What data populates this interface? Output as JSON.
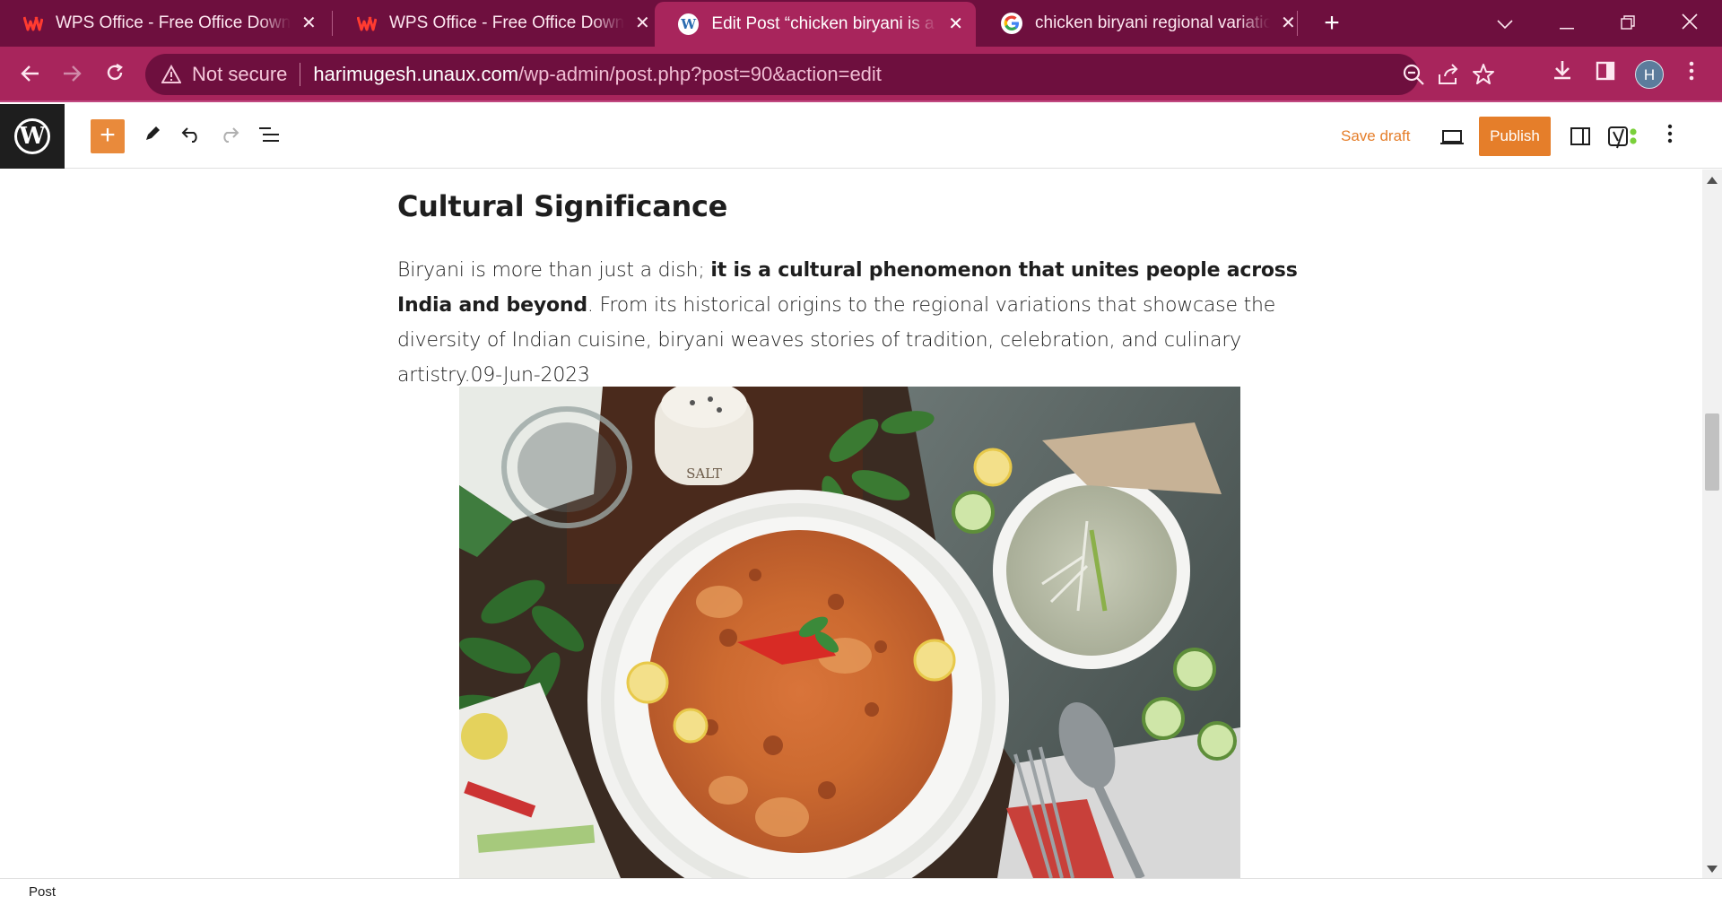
{
  "browser": {
    "tabs": [
      {
        "title": "WPS Office - Free Office Downlo",
        "icon": "wps-icon",
        "active": false
      },
      {
        "title": "WPS Office - Free Office Downlo",
        "icon": "wps-icon",
        "active": false
      },
      {
        "title": "Edit Post “chicken biryani is a wo",
        "icon": "wordpress-icon",
        "active": true
      },
      {
        "title": "chicken biryani regional variation",
        "icon": "google-icon",
        "active": false
      }
    ],
    "avatar_letter": "H",
    "address": {
      "security_label": "Not secure",
      "host": "harimugesh.unaux.com",
      "path": "/wp-admin/post.php?post=90&action=edit"
    },
    "colors": {
      "frame": "#6e0f3e",
      "active_tab": "#a8255c"
    }
  },
  "editor": {
    "header": {
      "save_draft_label": "Save draft",
      "publish_label": "Publish"
    },
    "content": {
      "heading": "Cultural Significance",
      "paragraph": {
        "text_before": "Biryani is more than just a dish; ",
        "bold_text": "it is a cultural phenomenon that unites people across India and beyond",
        "text_after": ". From its historical origins to the regional variations that showcase the diversity of Indian cuisine, biryani weaves stories of tradition, celebration, and culinary artistry.09-Jun-2023"
      },
      "image": {
        "salt_label": "SALT"
      }
    },
    "footer": {
      "breadcrumb": "Post"
    },
    "colors": {
      "accent": "#e57e2a",
      "inserter": "#e98a3b"
    }
  }
}
